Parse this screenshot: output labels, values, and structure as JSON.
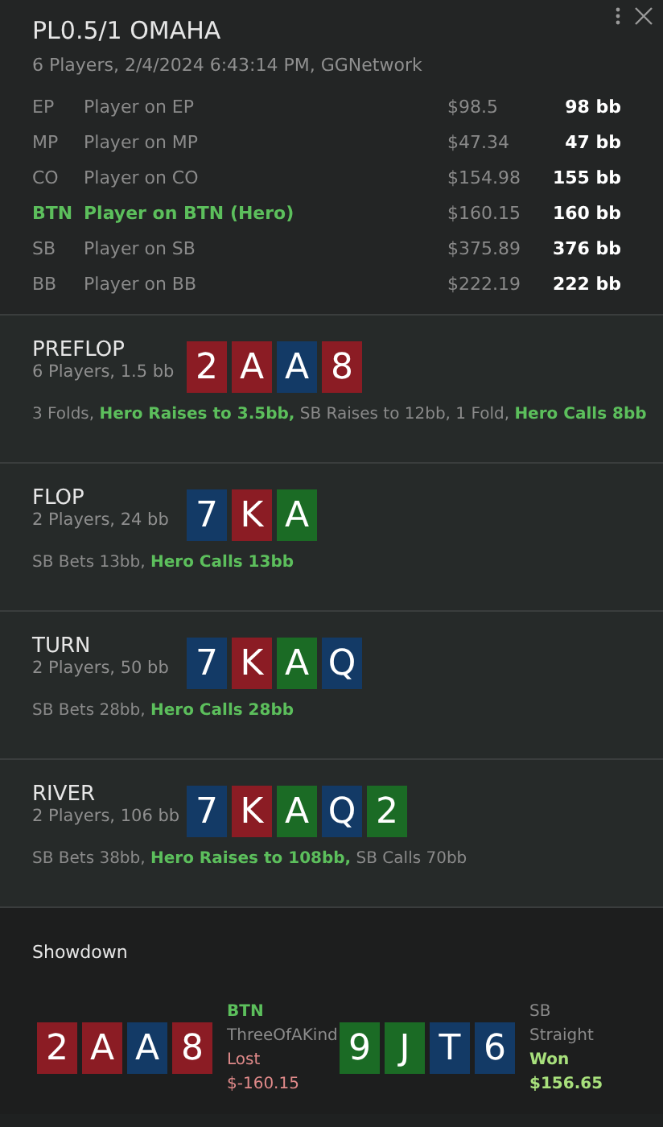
{
  "header": {
    "title": "PL0.5/1 OMAHA",
    "subtitle": "6 Players, 2/4/2024 6:43:14 PM, GGNetwork"
  },
  "players": [
    {
      "position": "EP",
      "name": "Player on EP",
      "money": "$98.5",
      "stack": "98 bb",
      "hero": false
    },
    {
      "position": "MP",
      "name": "Player on MP",
      "money": "$47.34",
      "stack": "47 bb",
      "hero": false
    },
    {
      "position": "CO",
      "name": "Player on CO",
      "money": "$154.98",
      "stack": "155 bb",
      "hero": false
    },
    {
      "position": "BTN",
      "name": "Player on BTN (Hero)",
      "money": "$160.15",
      "stack": "160 bb",
      "hero": true
    },
    {
      "position": "SB",
      "name": "Player on SB",
      "money": "$375.89",
      "stack": "376 bb",
      "hero": false
    },
    {
      "position": "BB",
      "name": "Player on BB",
      "money": "$222.19",
      "stack": "222 bb",
      "hero": false
    }
  ],
  "streets": [
    {
      "name": "PREFLOP",
      "info": "6 Players, 1.5 bb",
      "cards": [
        {
          "rank": "2",
          "color": "#8b1c24"
        },
        {
          "rank": "A",
          "color": "#8b1c24"
        },
        {
          "rank": "A",
          "color": "#133a66"
        },
        {
          "rank": "8",
          "color": "#8b1c24"
        }
      ],
      "actions": "3 Folds, **Hero Raises to 3.5bb,** SB Raises to 12bb, 1 Fold, **Hero Calls 8bb**"
    },
    {
      "name": "FLOP",
      "info": "2 Players, 24 bb",
      "cards": [
        {
          "rank": "7",
          "color": "#133a66"
        },
        {
          "rank": "K",
          "color": "#8b1c24"
        },
        {
          "rank": "A",
          "color": "#1b6b25"
        }
      ],
      "actions": "SB Bets 13bb, **Hero Calls 13bb**"
    },
    {
      "name": "TURN",
      "info": "2 Players, 50 bb",
      "cards": [
        {
          "rank": "7",
          "color": "#133a66"
        },
        {
          "rank": "K",
          "color": "#8b1c24"
        },
        {
          "rank": "A",
          "color": "#1b6b25"
        },
        {
          "rank": "Q",
          "color": "#133a66"
        }
      ],
      "actions": "SB Bets 28bb, **Hero Calls 28bb**"
    },
    {
      "name": "RIVER",
      "info": "2 Players, 106 bb",
      "cards": [
        {
          "rank": "7",
          "color": "#133a66"
        },
        {
          "rank": "K",
          "color": "#8b1c24"
        },
        {
          "rank": "A",
          "color": "#1b6b25"
        },
        {
          "rank": "Q",
          "color": "#133a66"
        },
        {
          "rank": "2",
          "color": "#1b6b25"
        }
      ],
      "actions": "SB Bets 38bb, **Hero Raises to 108bb,** SB Calls 70bb"
    }
  ],
  "showdown": {
    "title": "Showdown",
    "hands": [
      {
        "position": "BTN",
        "hero": true,
        "hand": "ThreeOfAKind",
        "result": "Lost",
        "won": false,
        "amount": "$-160.15",
        "cards": [
          {
            "rank": "2",
            "color": "#8b1c24"
          },
          {
            "rank": "A",
            "color": "#8b1c24"
          },
          {
            "rank": "A",
            "color": "#133a66"
          },
          {
            "rank": "8",
            "color": "#8b1c24"
          }
        ]
      },
      {
        "position": "SB",
        "hero": false,
        "hand": "Straight",
        "result": "Won",
        "won": true,
        "amount": "$156.65",
        "cards": [
          {
            "rank": "9",
            "color": "#1b6b25"
          },
          {
            "rank": "J",
            "color": "#1b6b25"
          },
          {
            "rank": "T",
            "color": "#133a66"
          },
          {
            "rank": "6",
            "color": "#133a66"
          }
        ]
      }
    ]
  }
}
